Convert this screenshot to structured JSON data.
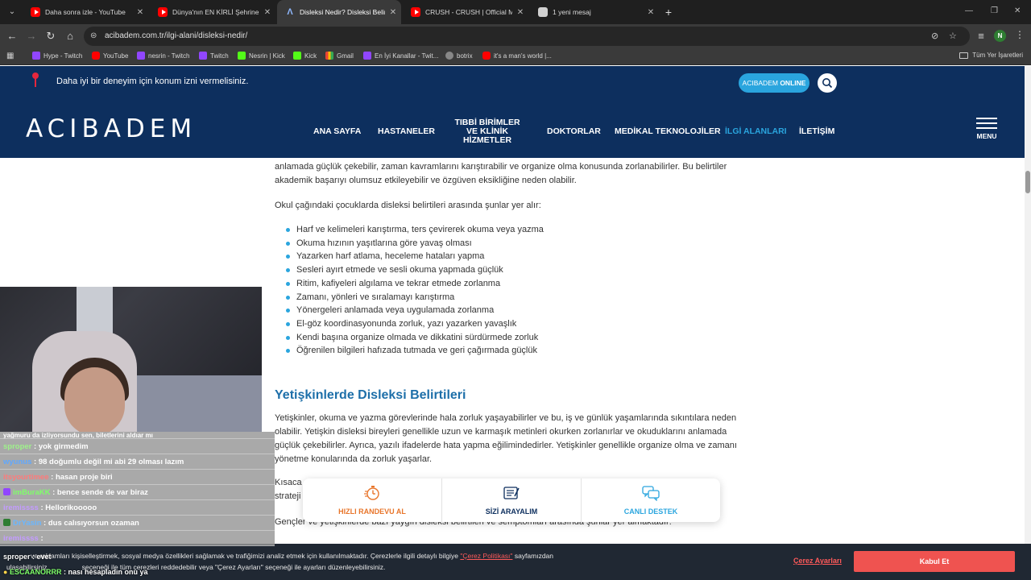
{
  "browser": {
    "tabs": [
      {
        "title": "Daha sonra izle - YouTube",
        "favicon": "youtube-icon",
        "active": false
      },
      {
        "title": "Dünya'nın EN KİRLİ Şehrine Gel",
        "favicon": "youtube-icon",
        "active": false
      },
      {
        "title": "Disleksi Nedir? Disleksi Belirtile",
        "favicon": "acibadem-icon",
        "active": true
      },
      {
        "title": "CRUSH - CRUSH | Official Music",
        "favicon": "youtube-icon",
        "active": false
      },
      {
        "title": "1 yeni mesaj",
        "favicon": "mail-icon",
        "active": false
      }
    ],
    "url": "acibadem.com.tr/ilgi-alani/disleksi-nedir/",
    "profile_initial": "N",
    "bookmarks": [
      {
        "label": "Hype - Twitch",
        "icon": "twitch-icon"
      },
      {
        "label": "YouTube",
        "icon": "youtube-icon"
      },
      {
        "label": "nesrin - Twitch",
        "icon": "twitch-icon"
      },
      {
        "label": "Twitch",
        "icon": "twitch-icon"
      },
      {
        "label": "Nesrin | Kick",
        "icon": "kick-icon"
      },
      {
        "label": "Kick",
        "icon": "kick-icon"
      },
      {
        "label": "Gmail",
        "icon": "gmail-icon"
      },
      {
        "label": "En İyi Kanallar - Twit...",
        "icon": "twitch-icon"
      },
      {
        "label": "botrix",
        "icon": "botrix-icon"
      },
      {
        "label": "it's a man's world |...",
        "icon": "youtube-icon"
      }
    ],
    "bookmarks_folder": "Tüm Yer İşaretleri"
  },
  "site": {
    "notice": "Daha iyi bir deneyim için konum izni vermelisiniz.",
    "online_btn_prefix": "ACIBADEM ",
    "online_btn_bold": "ONLINE",
    "logo": "ACIBADEM",
    "nav": [
      {
        "label": "ANA SAYFA"
      },
      {
        "label": "HASTANELER"
      },
      {
        "label_line1": "TIBBİ BİRİMLER",
        "label_line2": "VE KLİNİK HİZMETLER"
      },
      {
        "label": "DOKTORLAR"
      },
      {
        "label": "MEDİKAL TEKNOLOJİLER"
      },
      {
        "label": "İLGİ ALANLARI"
      },
      {
        "label": "İLETİŞİM"
      }
    ],
    "menu_label": "MENU"
  },
  "article": {
    "para_cut": "anlamada güçlük çekebilir, zaman kavramlarını karıştırabilir ve organize olma konusunda zorlanabilirler. Bu belirtiler akademik başarıyı olumsuz etkileyebilir ve özgüven eksikliğine neden olabilir.",
    "intro_school": "Okul çağındaki çocuklarda disleksi belirtileri arasında şunlar yer alır:",
    "school_list": [
      "Harf ve kelimeleri karıştırma, ters çevirerek okuma veya yazma",
      "Okuma hızının yaşıtlarına göre yavaş olması",
      "Yazarken harf atlama, heceleme hataları yapma",
      "Sesleri ayırt etmede ve sesli okuma yapmada güçlük",
      "Ritim, kafiyeleri algılama ve tekrar etmede zorlanma",
      "Zamanı, yönleri ve sıralamayı karıştırma",
      "Yönergeleri anlamada veya uygulamada zorlanma",
      "El-göz koordinasyonunda zorluk, yazı yazarken yavaşlık",
      "Kendi başına organize olmada ve dikkatini sürdürmede zorluk",
      "Öğrenilen bilgileri hafızada tutmada ve geri çağırmada güçlük"
    ],
    "h2_adult": "Yetişkinlerde Disleksi Belirtileri",
    "adult_para": "Yetişkinler, okuma ve yazma görevlerinde hala zorluk yaşayabilirler ve bu, iş ve günlük yaşamlarında sıkıntılara neden olabilir. Yetişkin disleksi bireyleri genellikle uzun ve karmaşık metinleri okurken zorlanırlar ve okuduklarını anlamada güçlük çekebilirler. Ayrıca, yazılı ifadelerde hata yapma eğilimindedirler. Yetişkinler genellikle organize olma ve zamanı yönetme konularında da zorluk yaşarlar.",
    "partial_line1": "Kısaca",
    "partial_line2": "strateji",
    "teen_para": "Gençler ve yetişkinlerde bazı yaygın disleksi belirtileri ve semptomları arasında şunlar yer almaktadır:"
  },
  "actions": [
    {
      "label": "HIZLI RANDEVU AL",
      "icon": "stopwatch-icon",
      "color": "#e8752a"
    },
    {
      "label": "SİZİ ARAYALIM",
      "icon": "form-icon",
      "color": "#0d2f5e"
    },
    {
      "label": "CANLI DESTEK",
      "icon": "chat-bubbles-icon",
      "color": "#2aa5de"
    }
  ],
  "cookie": {
    "line1_a": "ve reklamları kişiselleştirmek, sosyal medya özellikleri sağlamak ve trafiğimizi analiz etmek için kullanılmaktadır. Çerezlerle ilgili detaylı bilgiye",
    "policy_link": "\"Çerez Politikası\"",
    "line1_b": "sayfamızdan",
    "line2_a": "ulaşabilirsiniz.",
    "line2_b": "seçeneği ile tüm çerezleri reddedebilir veya \"Çerez Ayarları\" seçeneği ile ayarları düzenleyebilirsiniz.",
    "settings_label": "Çerez Ayarları",
    "accept_label": "Kabul Et"
  },
  "chat": {
    "messages": [
      {
        "user": "",
        "text": "yağmuru da izliyorsundu sen, biletlerini aldıar mı",
        "color": "#ff9a3c"
      },
      {
        "user": "sproper",
        "text": " : yok girmedim",
        "color": "#9ef28a"
      },
      {
        "user": "wyunus",
        "text": " : 98 doğumlu değil mi abi 29 olması lazım",
        "color": "#5fa8ff"
      },
      {
        "user": "itsyourtimee",
        "text": " : hasan proje biri",
        "color": "#ff7a7a"
      },
      {
        "user": "imBuraKK",
        "text": " : bence sende de var biraz",
        "color": "#7fff6a"
      },
      {
        "user": "iremissss",
        "text": " : Hellorikooooo",
        "color": "#c39bff"
      },
      {
        "user": "DrYasin",
        "text": " : dus calısıyorsun ozaman",
        "color": "#6ab7ff"
      },
      {
        "user": "iremissss",
        "text": " :",
        "color": "#c39bff"
      }
    ],
    "bottom1_user": "sproper",
    "bottom1_text": " : evet",
    "bottom2_user": "ESCAANORRR",
    "bottom2_text": " : nası hesapladın onu ya"
  }
}
